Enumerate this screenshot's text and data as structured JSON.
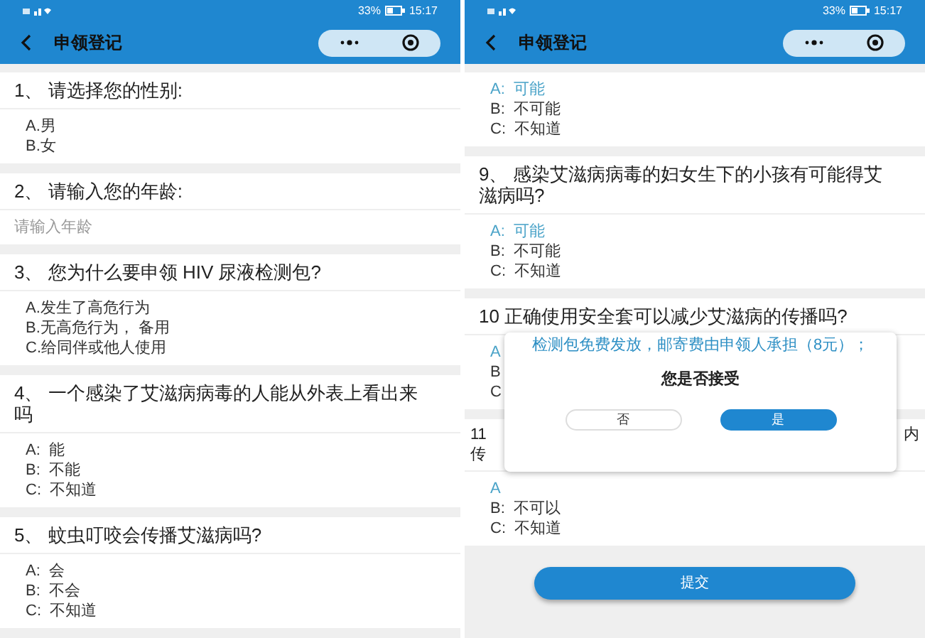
{
  "screens": [
    {
      "status_bar": {
        "battery": "33%",
        "time": "15:17"
      },
      "nav": {
        "title": "申领登记"
      },
      "blocks": [
        {
          "kind": "choice",
          "title": "1、 请选择您的性别:",
          "options": [
            {
              "text": "A.男",
              "selected": false
            },
            {
              "text": "B.女",
              "selected": false
            }
          ]
        },
        {
          "kind": "input",
          "title": "2、 请输入您的年龄:",
          "placeholder": "请输入年龄"
        },
        {
          "kind": "choice",
          "title": "3、 您为什么要申领 HIV 尿液检测包?",
          "options": [
            {
              "text": "A.发生了高危行为",
              "selected": false
            },
            {
              "text": "B.无高危行为， 备用",
              "selected": false
            },
            {
              "text": "C.给同伴或他人使用",
              "selected": false
            }
          ]
        },
        {
          "kind": "choice",
          "title": "4、 一个感染了艾滋病病毒的人能从外表上看出来吗",
          "options": [
            {
              "text": "A:  能",
              "selected": false
            },
            {
              "text": "B:  不能",
              "selected": false
            },
            {
              "text": "C:  不知道",
              "selected": false
            }
          ]
        },
        {
          "kind": "choice",
          "title": "5、 蚊虫叮咬会传播艾滋病吗?",
          "options": [
            {
              "text": "A:  会",
              "selected": false
            },
            {
              "text": "B:  不会",
              "selected": false
            },
            {
              "text": "C:  不知道",
              "selected": false
            }
          ]
        }
      ]
    },
    {
      "status_bar": {
        "battery": "33%",
        "time": "15:17"
      },
      "nav": {
        "title": "申领登记"
      },
      "blocks": [
        {
          "kind": "choice",
          "options": [
            {
              "text": "A:  可能",
              "selected": true
            },
            {
              "text": "B:  不可能",
              "selected": false
            },
            {
              "text": "C:  不知道",
              "selected": false
            }
          ]
        },
        {
          "kind": "choice",
          "title": "9、 感染艾滋病病毒的妇女生下的小孩有可能得艾滋病吗?",
          "options": [
            {
              "text": "A:  可能",
              "selected": true
            },
            {
              "text": "B:  不可能",
              "selected": false
            },
            {
              "text": "C:  不知道",
              "selected": false
            }
          ]
        },
        {
          "kind": "choice",
          "title": "10  正确使用安全套可以减少艾滋病的传播吗?",
          "options": [
            {
              "text": "A",
              "selected": true
            },
            {
              "text": "B",
              "selected": false
            },
            {
              "text": "C",
              "selected": false
            }
          ]
        },
        {
          "kind": "partial",
          "title_start": "11",
          "title_end": "内",
          "title_line2": "传",
          "options": [
            {
              "text": "A",
              "selected": true
            },
            {
              "text": "B:  不可以",
              "selected": false
            },
            {
              "text": "C:  不知道",
              "selected": false
            }
          ]
        }
      ],
      "submit": "提交",
      "dialog": {
        "message": "检测包免费发放，邮寄费由申领人承担（8元）；",
        "question": "您是否接受",
        "buttons": [
          {
            "label": "否",
            "kind": "secondary"
          },
          {
            "label": "是",
            "kind": "primary"
          }
        ]
      }
    }
  ]
}
